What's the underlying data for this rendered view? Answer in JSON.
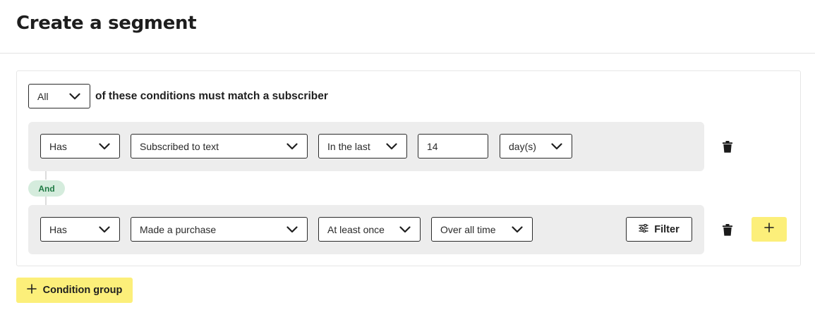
{
  "header": {
    "title": "Create a segment"
  },
  "match": {
    "quantifier": "All",
    "label": "of these conditions must match a subscriber"
  },
  "conditions": [
    {
      "has": "Has",
      "event": "Subscribed to text",
      "timeframe": "In the last",
      "amount": "14",
      "unit": "day(s)"
    },
    {
      "has": "Has",
      "event": "Made a purchase",
      "frequency": "At least once",
      "range": "Over all time",
      "filter_label": "Filter"
    }
  ],
  "connector": {
    "label": "And"
  },
  "actions": {
    "condition_group_label": "Condition group"
  },
  "icons": {
    "chevron": "chevron-down-icon",
    "trash": "trash-icon",
    "plus": "plus-icon",
    "filter": "sliders-icon"
  },
  "colors": {
    "accent_yellow": "#fcef7a",
    "and_pill_bg": "#d5ecdd",
    "and_pill_text": "#1f7a44",
    "row_bg": "#ededed"
  }
}
